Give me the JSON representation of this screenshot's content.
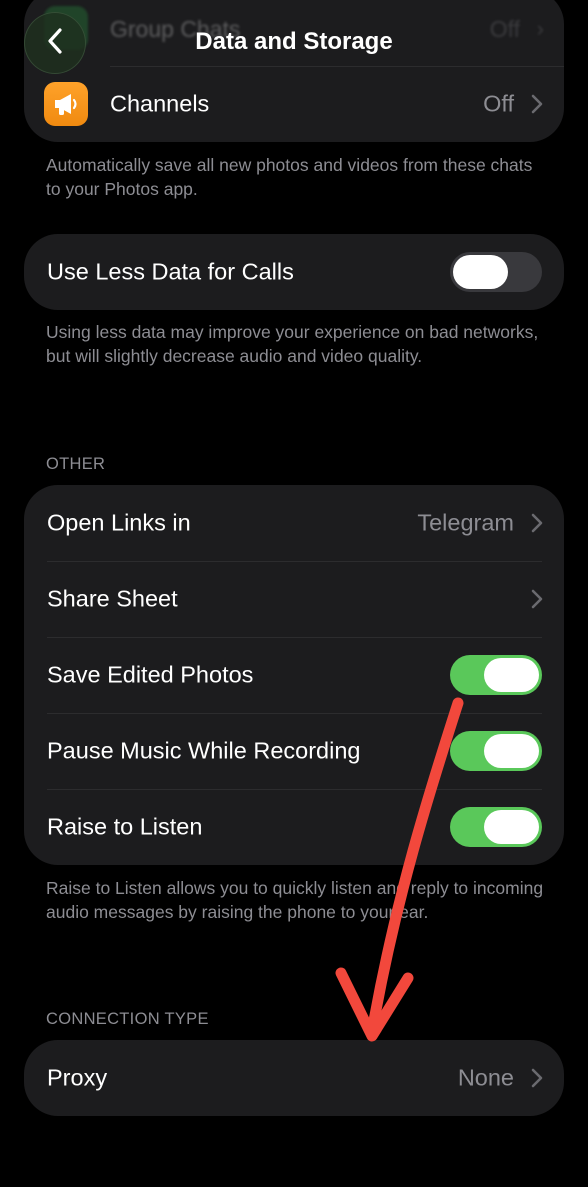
{
  "nav": {
    "title": "Data and Storage",
    "back_icon": "chevron-left-icon"
  },
  "auto_save": {
    "ghost_row": {
      "label": "Group Chats",
      "value": "Off"
    },
    "channels_row": {
      "label": "Channels",
      "value": "Off",
      "icon": "megaphone-icon",
      "icon_color": "#f7961c"
    },
    "footnote": "Automatically save all new photos and videos from these chats to your Photos app."
  },
  "calls": {
    "label": "Use Less Data for Calls",
    "toggle_on": false,
    "footnote": "Using less data may improve your experience on bad networks, but will slightly decrease audio and video quality."
  },
  "other": {
    "header": "OTHER",
    "rows": [
      {
        "label": "Open Links in",
        "value": "Telegram",
        "kind": "disclosure"
      },
      {
        "label": "Share Sheet",
        "value": "",
        "kind": "disclosure"
      },
      {
        "label": "Save Edited Photos",
        "kind": "toggle",
        "on": true
      },
      {
        "label": "Pause Music While Recording",
        "kind": "toggle",
        "on": true
      },
      {
        "label": "Raise to Listen",
        "kind": "toggle",
        "on": true
      }
    ],
    "footnote": "Raise to Listen allows you to quickly listen and reply to incoming audio messages by raising the phone to your ear."
  },
  "connection": {
    "header": "CONNECTION TYPE",
    "proxy": {
      "label": "Proxy",
      "value": "None"
    }
  },
  "colors": {
    "background": "#000000",
    "cell": "#1c1c1e",
    "toggle_on": "#5ac85a",
    "toggle_off": "#39393d",
    "secondary_text": "#8d8d93",
    "annotation_arrow": "#f2483c"
  }
}
